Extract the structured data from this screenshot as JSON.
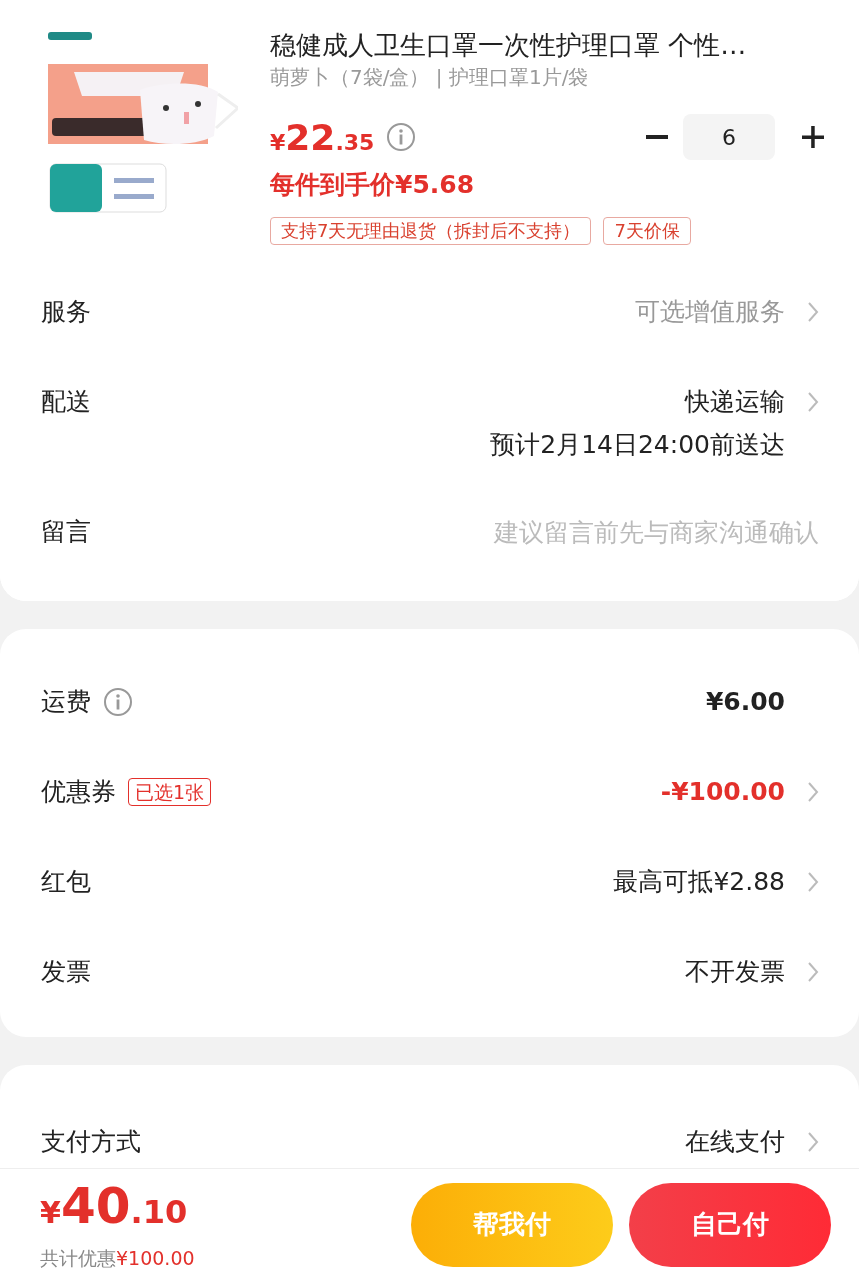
{
  "product": {
    "title": "稳健成人卫生口罩一次性护理口罩 个性…",
    "spec": "萌萝卜（7袋/盒） | 护理口罩1片/袋",
    "price": {
      "currency": "¥",
      "integer": "22",
      "decimal": ".35"
    },
    "quantity": "6",
    "unit_price": "每件到手价¥5.68",
    "tags": [
      "支持7天无理由退货（拆封后不支持）",
      "7天价保"
    ]
  },
  "sections": [
    {
      "rows": [
        {
          "kind": "link",
          "label": "服务",
          "value": "可选增值服务",
          "color": "#999999",
          "bold": false
        },
        {
          "kind": "link",
          "label": "配送",
          "value": "快递运输",
          "color": "#222222",
          "bold": false,
          "note": "预计2月14日24:00前送达"
        },
        {
          "kind": "field",
          "label": "留言",
          "placeholder": "建议留言前先与商家沟通确认"
        }
      ]
    },
    {
      "rows": [
        {
          "kind": "info",
          "label": "运费",
          "value": "¥6.00",
          "color": "#222222",
          "bold": true
        },
        {
          "kind": "link",
          "label": "优惠券",
          "badge": "已选1张",
          "value": "-¥100.00",
          "color": "#e3302b",
          "bold": true
        },
        {
          "kind": "link",
          "label": "红包",
          "value": "最高可抵¥2.88",
          "color": "#222222",
          "bold": false
        },
        {
          "kind": "link",
          "label": "发票",
          "value": "不开发票",
          "color": "#222222",
          "bold": false
        }
      ]
    },
    {
      "rows": [
        {
          "kind": "link",
          "label": "支付方式",
          "value": "在线支付",
          "color": "#222222",
          "bold": false
        }
      ]
    }
  ],
  "checkout": {
    "total": {
      "currency": "¥",
      "integer": "40",
      "decimal": ".10"
    },
    "saving_label": "共计优惠",
    "saving_amount": "¥100.00",
    "buttons": [
      {
        "label": "帮我付",
        "kind": "secondary"
      },
      {
        "label": "自己付",
        "kind": "primary"
      }
    ]
  }
}
